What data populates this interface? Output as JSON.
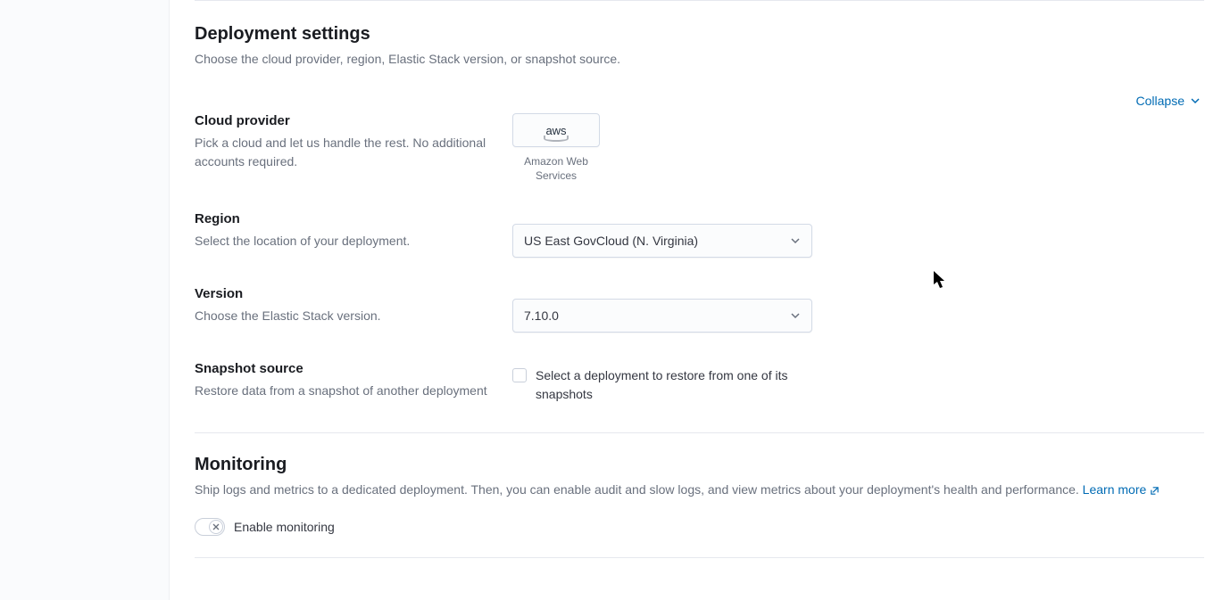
{
  "collapse_label": "Collapse",
  "deployment": {
    "title": "Deployment settings",
    "subtitle": "Choose the cloud provider, region, Elastic Stack version, or snapshot source."
  },
  "cloud_provider": {
    "label": "Cloud provider",
    "desc": "Pick a cloud and let us handle the rest. No additional accounts required.",
    "logo_text": "aws",
    "name": "Amazon Web Services"
  },
  "region": {
    "label": "Region",
    "desc": "Select the location of your deployment.",
    "value": "US East GovCloud (N. Virginia)"
  },
  "version": {
    "label": "Version",
    "desc": "Choose the Elastic Stack version.",
    "value": "7.10.0"
  },
  "snapshot": {
    "label": "Snapshot source",
    "desc": "Restore data from a snapshot of another deployment",
    "checkbox_label": "Select a deployment to restore from one of its snapshots"
  },
  "monitoring": {
    "title": "Monitoring",
    "desc": "Ship logs and metrics to a dedicated deployment. Then, you can enable audit and slow logs, and view metrics about your deployment's health and performance. ",
    "learn_more": "Learn more",
    "toggle_label": "Enable monitoring"
  }
}
